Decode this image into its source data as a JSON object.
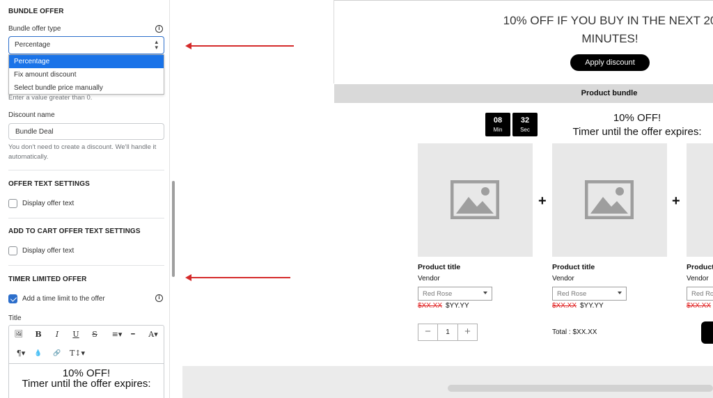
{
  "panel": {
    "bundle_offer_title": "BUNDLE OFFER",
    "bundle_offer_type_label": "Bundle offer type",
    "bundle_offer_type_value": "Percentage",
    "dropdown_options": [
      "Percentage",
      "Fix amount discount",
      "Select bundle price manually"
    ],
    "value_help": "Enter a value greater than 0.",
    "discount_name_label": "Discount name",
    "discount_name_value": "Bundle Deal",
    "discount_help": "You don't need to create a discount. We'll handle it automatically.",
    "offer_text_title": "OFFER TEXT SETTINGS",
    "offer_text_checkbox": "Display offer text",
    "atc_title": "ADD TO CART OFFER TEXT SETTINGS",
    "atc_checkbox": "Display offer text",
    "timer_title": "TIMER LIMITED OFFER",
    "timer_checkbox": "Add a time limit to the offer",
    "title_label": "Title",
    "toolbar": {
      "image": "🖼",
      "bold": "B",
      "italic": "I",
      "underline": "U",
      "strike": "S",
      "align": "≡▾",
      "hr": "━",
      "font": "A▾",
      "paragraph": "¶▾",
      "color": "💧",
      "link": "🔗",
      "size": "T↕▾"
    },
    "editor_line1": "10% OFF!",
    "editor_line2": "Timer until the offer expires:"
  },
  "preview": {
    "headline_line1": "10% OFF IF YOU BUY IN THE NEXT 20",
    "headline_line2": "MINUTES!",
    "apply_button": "Apply discount",
    "bundle_bar": "Product bundle",
    "timer_minutes": "08",
    "timer_min_unit": "Min",
    "timer_seconds": "32",
    "timer_sec_unit": "Sec",
    "offer_line1": "10% OFF!",
    "offer_line2": "Timer until the offer expires:",
    "products": [
      {
        "title": "Product title",
        "vendor": "Vendor",
        "variant": "Red Rose",
        "old_price": "$XX.XX",
        "new_price": "$YY.YY"
      },
      {
        "title": "Product title",
        "vendor": "Vendor",
        "variant": "Red Rose",
        "old_price": "$XX.XX",
        "new_price": "$YY.YY"
      },
      {
        "title": "Product",
        "vendor": "Vendor",
        "variant": "Red Ro",
        "old_price": "$XX.XX",
        "new_price": ""
      }
    ],
    "plus_sign": "+",
    "quantity": "1",
    "qty_minus": "−",
    "qty_plus": "+",
    "total": "Total : $XX.XX"
  },
  "colors": {
    "accent_blue": "#2c6ecb",
    "dropdown_active": "#1a73e8",
    "annotation_arrow": "#d42a2a",
    "strike_price": "#e02020"
  }
}
